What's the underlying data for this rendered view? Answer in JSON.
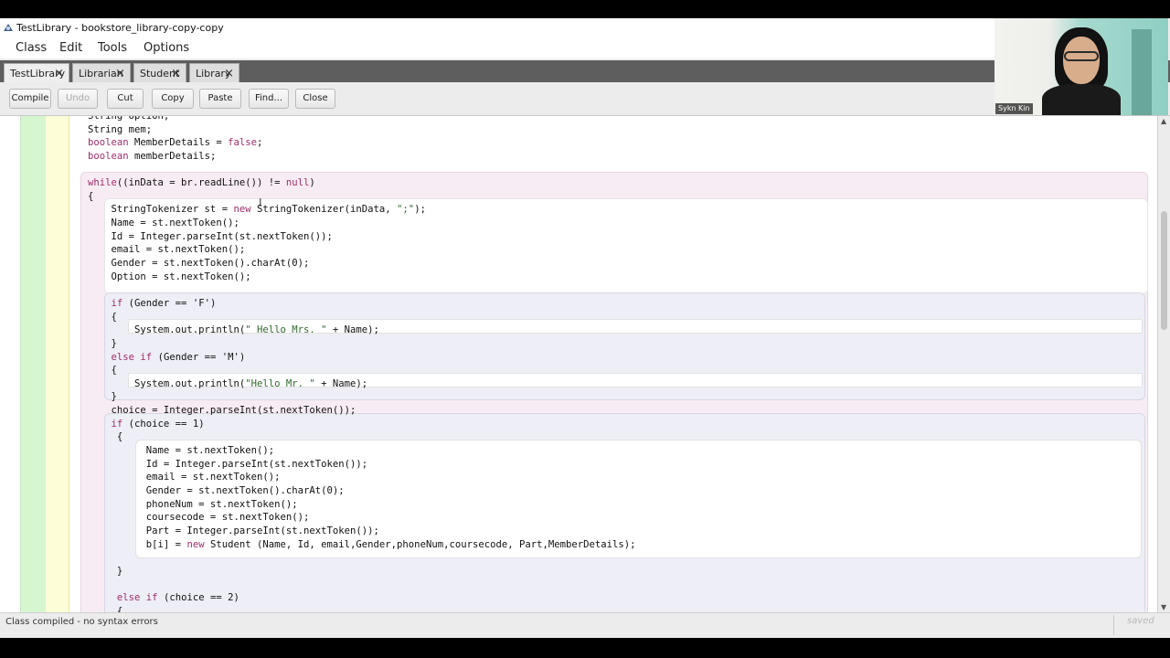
{
  "window": {
    "title": "TestLibrary - bookstore_library-copy-copy"
  },
  "menus": [
    "Class",
    "Edit",
    "Tools",
    "Options"
  ],
  "tabs": [
    {
      "label": "TestLibrary",
      "active": true
    },
    {
      "label": "Librarian",
      "active": false
    },
    {
      "label": "Student",
      "active": false
    },
    {
      "label": "Library",
      "active": false
    }
  ],
  "toolbar": {
    "compile": "Compile",
    "undo": "Undo",
    "cut": "Cut",
    "copy": "Copy",
    "paste": "Paste",
    "find": "Find...",
    "close": "Close"
  },
  "code_lines": [
    "String option;",
    "String mem;",
    "boolean MemberDetails = false;",
    "boolean memberDetails;",
    "",
    "while((inData = br.readLine()) != null)",
    "{",
    "    StringTokenizer st = new StringTokenizer(inData, \";\");",
    "    Name = st.nextToken();",
    "    Id = Integer.parseInt(st.nextToken());",
    "    email = st.nextToken();",
    "    Gender = st.nextToken().charAt(0);",
    "    Option = st.nextToken();",
    "",
    "    if (Gender == 'F')",
    "    {",
    "        System.out.println(\" Hello Mrs. \" + Name);",
    "    }",
    "    else if (Gender == 'M')",
    "    {",
    "        System.out.println(\"Hello Mr. \" + Name);",
    "    }",
    "    choice = Integer.parseInt(st.nextToken());",
    "    if (choice == 1)",
    "     {",
    "          Name = st.nextToken();",
    "          Id = Integer.parseInt(st.nextToken());",
    "          email = st.nextToken();",
    "          Gender = st.nextToken().charAt(0);",
    "          phoneNum = st.nextToken();",
    "          coursecode = st.nextToken();",
    "          Part = Integer.parseInt(st.nextToken());",
    "          b[i] = new Student (Name, Id, email,Gender,phoneNum,coursecode, Part,MemberDetails);",
    "",
    "     }",
    "",
    "     else if (choice == 2)",
    "     {"
  ],
  "status": {
    "message": "Class compiled - no syntax errors",
    "saved": "saved"
  },
  "webcam": {
    "participant_name": "Sykn Kin"
  },
  "colors": {
    "keyword": "#a02d6b",
    "string": "#2f6b2b",
    "gutter_green": "#d6f6d0",
    "gutter_yellow": "#fdfdd8"
  }
}
